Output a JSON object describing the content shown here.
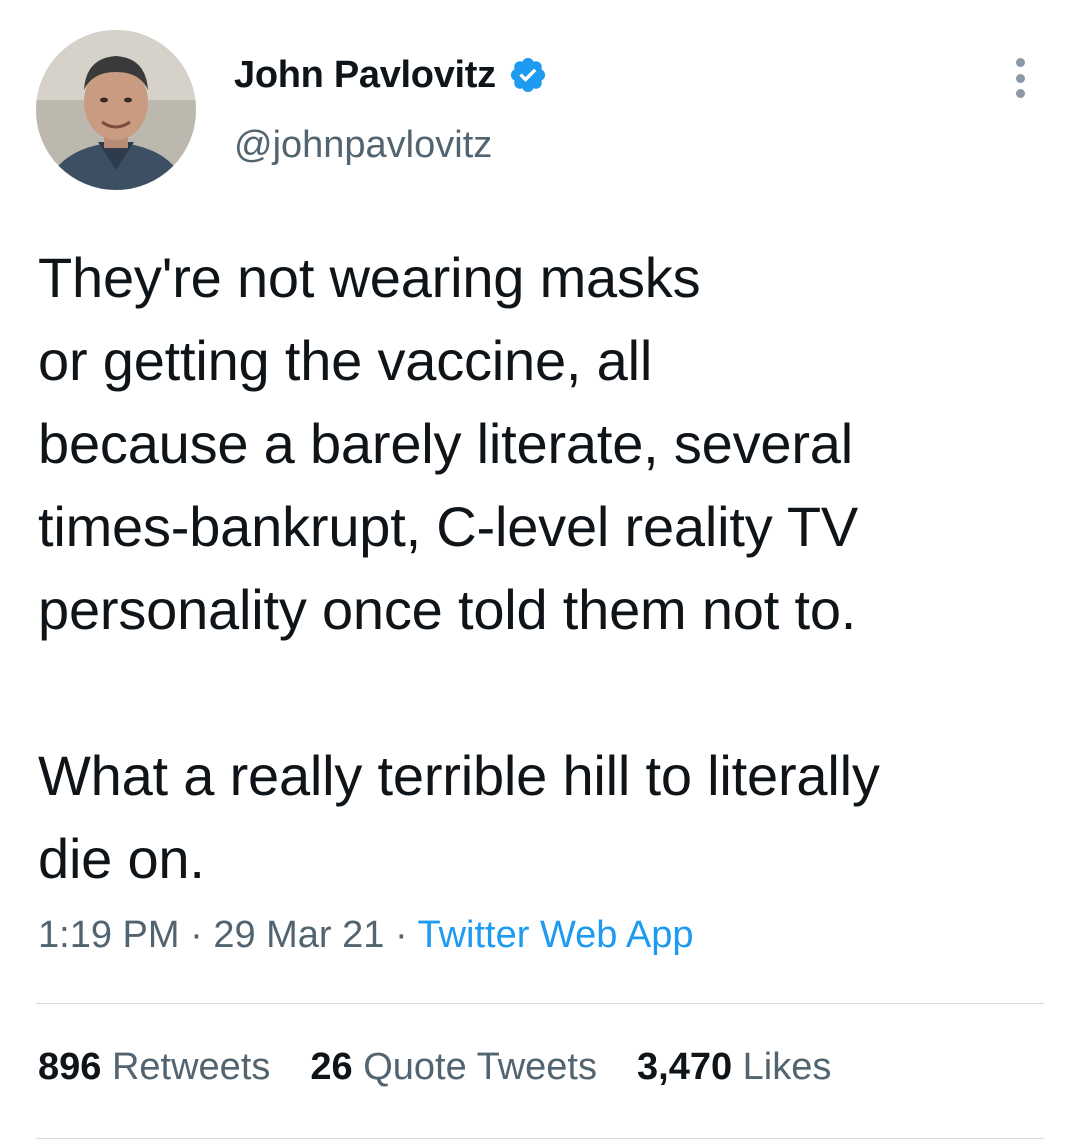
{
  "author": {
    "display_name": "John Pavlovitz",
    "handle": "@johnpavlovitz",
    "verified": true,
    "verified_color": "#1d9bf0"
  },
  "tweet": {
    "text": "They're not wearing masks\nor getting the vaccine, all\nbecause a barely literate, several\ntimes-bankrupt, C-level reality TV\npersonality once told them not to.\n\nWhat a really terrible hill to literally\ndie on.",
    "time": "1:19 PM",
    "separator": " · ",
    "date": "29 Mar 21",
    "source": "Twitter Web App"
  },
  "stats": {
    "retweets_count": "896",
    "retweets_label": "Retweets",
    "quotes_count": "26",
    "quotes_label": "Quote Tweets",
    "likes_count": "3,470",
    "likes_label": "Likes"
  },
  "icons": {
    "more": "more-options-icon",
    "verified": "verified-badge-icon"
  },
  "colors": {
    "link": "#1d9bf0",
    "secondary_text": "#536471",
    "primary_text": "#0f1419"
  }
}
